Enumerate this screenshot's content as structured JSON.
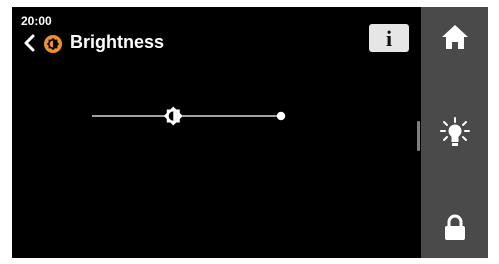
{
  "status": {
    "time": "20:00"
  },
  "header": {
    "title": "Brightness",
    "back_icon": "chevron-left-icon",
    "page_icon": "brightness-icon",
    "info_label": "i"
  },
  "brightness": {
    "level_fraction": 0.43
  },
  "sidebar": {
    "items": [
      {
        "icon": "home-icon"
      },
      {
        "icon": "light-bulb-icon",
        "active": true
      },
      {
        "icon": "lock-icon"
      }
    ]
  },
  "colors": {
    "screen_bg": "#000000",
    "sidebar_bg": "#4a4a4a",
    "accent": "#f0922b",
    "foreground": "#ffffff",
    "info_button_bg": "#e6e6e6"
  }
}
